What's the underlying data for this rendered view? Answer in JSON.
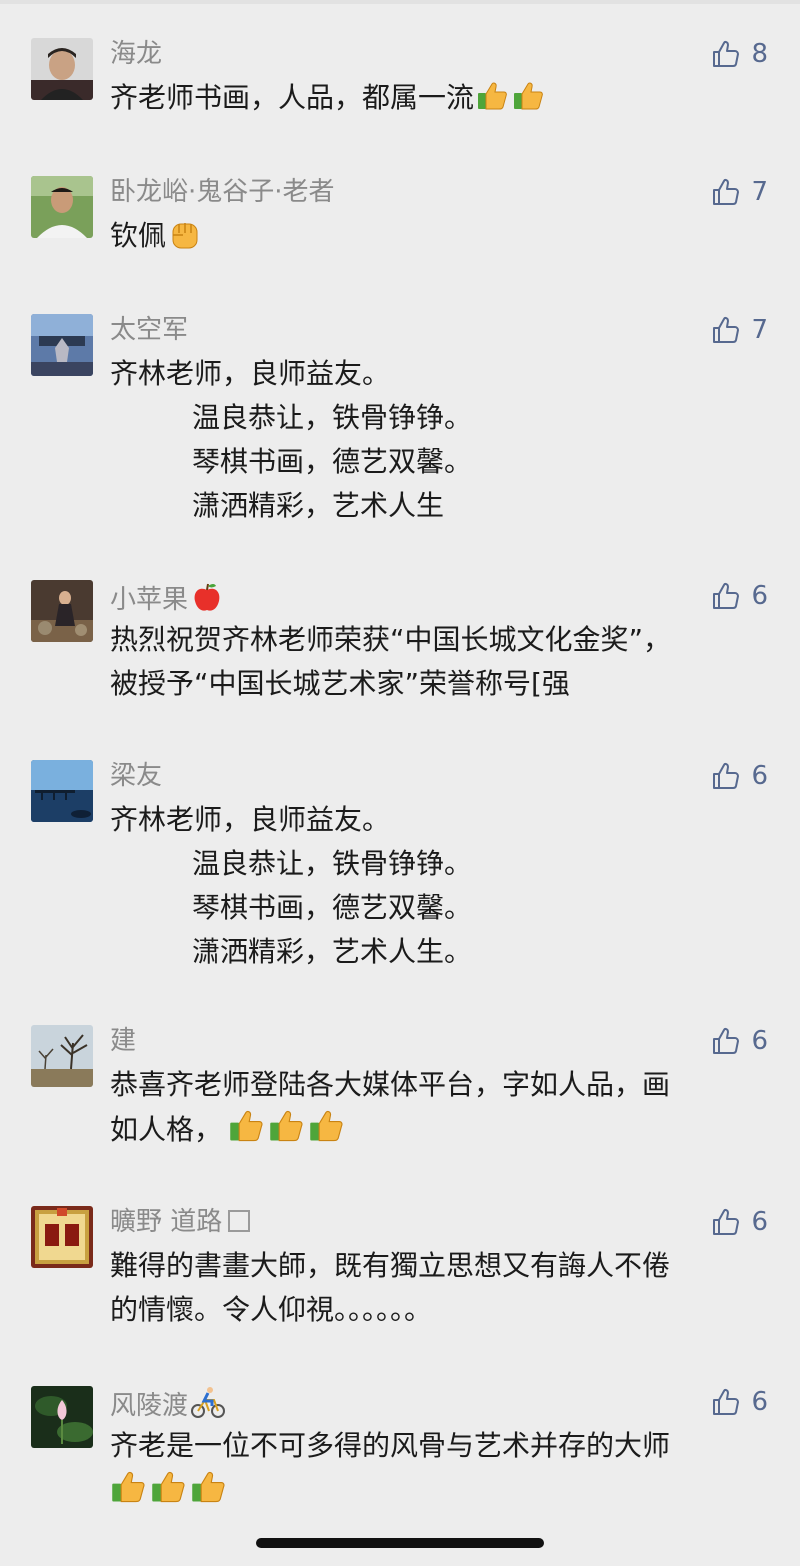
{
  "colors": {
    "background": "#ededed",
    "name": "#8a8a8a",
    "text": "#1b1b1b",
    "like_accent": "#57698f"
  },
  "comments": [
    {
      "name": "海龙",
      "likes": "8",
      "lines": [
        "齐老师书画，人品，都属一流"
      ],
      "emojis": [
        "thumbs-up-emoji",
        "thumbs-up-emoji"
      ]
    },
    {
      "name": "卧龙峪·鬼谷子·老者",
      "likes": "7",
      "lines": [
        "钦佩"
      ],
      "emojis": [
        "raised-fist-emoji"
      ]
    },
    {
      "name": "太空军",
      "likes": "7",
      "lines": [
        "齐林老师，良师益友。",
        "温良恭让，铁骨铮铮。",
        "琴棋书画，德艺双馨。",
        "潇洒精彩，艺术人生"
      ]
    },
    {
      "name": "小苹果",
      "name_emoji": "red-apple-emoji",
      "likes": "6",
      "lines": [
        "热烈祝贺齐林老师荣获“中国长城文化金奖”，",
        "被授予“中国长城艺术家”荣誉称号[强"
      ]
    },
    {
      "name": "梁友",
      "likes": "6",
      "lines": [
        "齐林老师，良师益友。",
        "温良恭让，铁骨铮铮。",
        "琴棋书画，德艺双馨。",
        "潇洒精彩，艺术人生。"
      ]
    },
    {
      "name": "建",
      "likes": "6",
      "lines": [
        "恭喜齐老师登陆各大媒体平台，字如人品，画",
        "如人格，"
      ],
      "emojis": [
        "thumbs-up-emoji",
        "thumbs-up-emoji",
        "thumbs-up-emoji"
      ]
    },
    {
      "name": "曠野 道路",
      "likes": "6",
      "lines": [
        "難得的書畫大師，既有獨立思想又有誨人不倦",
        "的情懷。令人仰視。。。。。。"
      ]
    },
    {
      "name": "风陵渡",
      "name_emoji": "cyclist-emoji",
      "likes": "6",
      "lines": [
        "齐老是一位不可多得的风骨与艺术并存的大师"
      ],
      "emojis": [
        "thumbs-up-emoji",
        "thumbs-up-emoji",
        "thumbs-up-emoji"
      ]
    }
  ]
}
